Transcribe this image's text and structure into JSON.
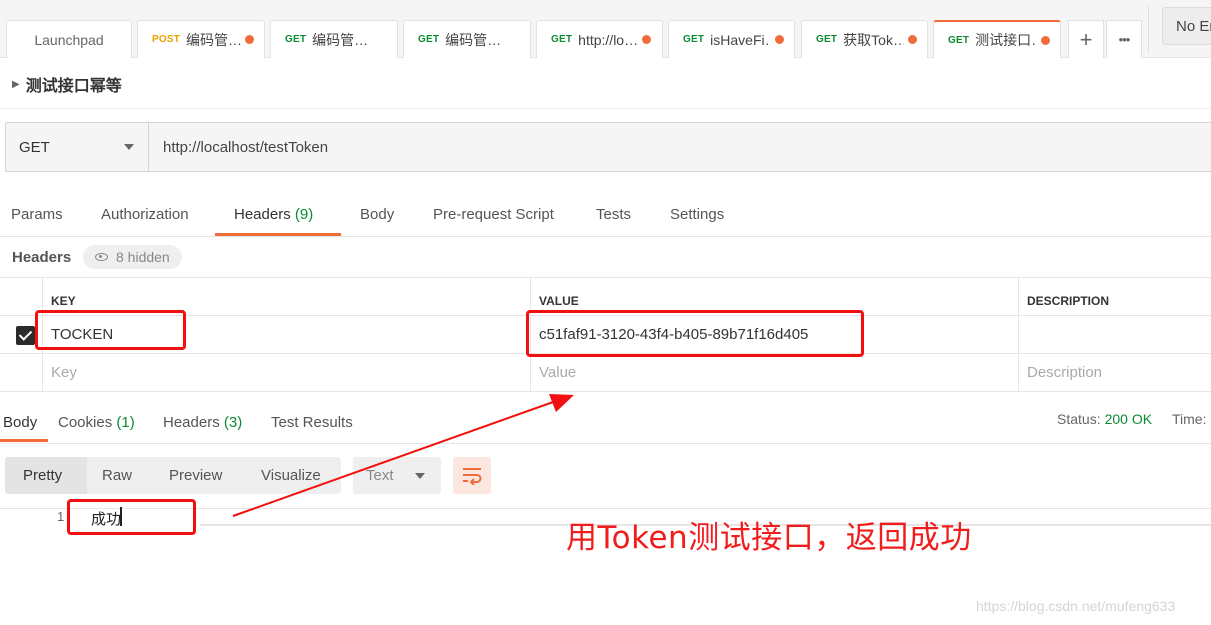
{
  "tabs": [
    {
      "method": "",
      "title": "Launchpad",
      "dot": false,
      "active": false
    },
    {
      "method": "POST",
      "title": "编码管…",
      "dot": true,
      "active": false
    },
    {
      "method": "GET",
      "title": "编码管…",
      "dot": false,
      "active": false
    },
    {
      "method": "GET",
      "title": "编码管…",
      "dot": false,
      "active": false
    },
    {
      "method": "GET",
      "title": "http://lo…",
      "dot": true,
      "active": false
    },
    {
      "method": "GET",
      "title": "isHaveFi…",
      "dot": true,
      "active": false
    },
    {
      "method": "GET",
      "title": "获取Tok…",
      "dot": true,
      "active": false
    },
    {
      "method": "GET",
      "title": "测试接口…",
      "dot": true,
      "active": true
    }
  ],
  "tab_actions": {
    "add": "+",
    "more": "•••"
  },
  "environment": "No En",
  "request_name": "测试接口幂等",
  "urlbar": {
    "method": "GET",
    "url": "http://localhost/testToken"
  },
  "request_tabs": {
    "params": "Params",
    "authorization": "Authorization",
    "headers": "Headers",
    "headers_count": "(9)",
    "body": "Body",
    "prerequest": "Pre-request Script",
    "tests": "Tests",
    "settings": "Settings"
  },
  "headers_section": {
    "title": "Headers",
    "hidden": "8 hidden"
  },
  "headers_table": {
    "columns": {
      "key": "KEY",
      "value": "VALUE",
      "description": "DESCRIPTION"
    },
    "rows": [
      {
        "key": "TOCKEN",
        "value": "c51faf91-3120-43f4-b405-89b71f16d405",
        "description": "",
        "checked": true
      }
    ],
    "placeholders": {
      "key": "Key",
      "value": "Value",
      "description": "Description"
    }
  },
  "response_tabs": {
    "body": "Body",
    "cookies": "Cookies",
    "cookies_count": "(1)",
    "headers": "Headers",
    "headers_count": "(3)",
    "test_results": "Test Results"
  },
  "response_status": {
    "label": "Status:",
    "value": "200 OK",
    "time_label": "Time:"
  },
  "view_modes": {
    "pretty": "Pretty",
    "raw": "Raw",
    "preview": "Preview",
    "visualize": "Visualize",
    "format": "Text"
  },
  "editor": {
    "line_number": "1",
    "content": "成功"
  },
  "annotation": {
    "text": "用Token测试接口，返回成功"
  },
  "watermark": "https://blog.csdn.net/mufeng633",
  "colors": {
    "accent": "#f26b3a",
    "get": "#0c8a33",
    "post": "#e8a400",
    "annotation": "#f10f0f"
  },
  "icons": [
    "plus-icon",
    "more-icon",
    "caret-right-icon",
    "chevron-down-icon",
    "eye-icon",
    "checkbox-icon",
    "wrap-lines-icon"
  ]
}
